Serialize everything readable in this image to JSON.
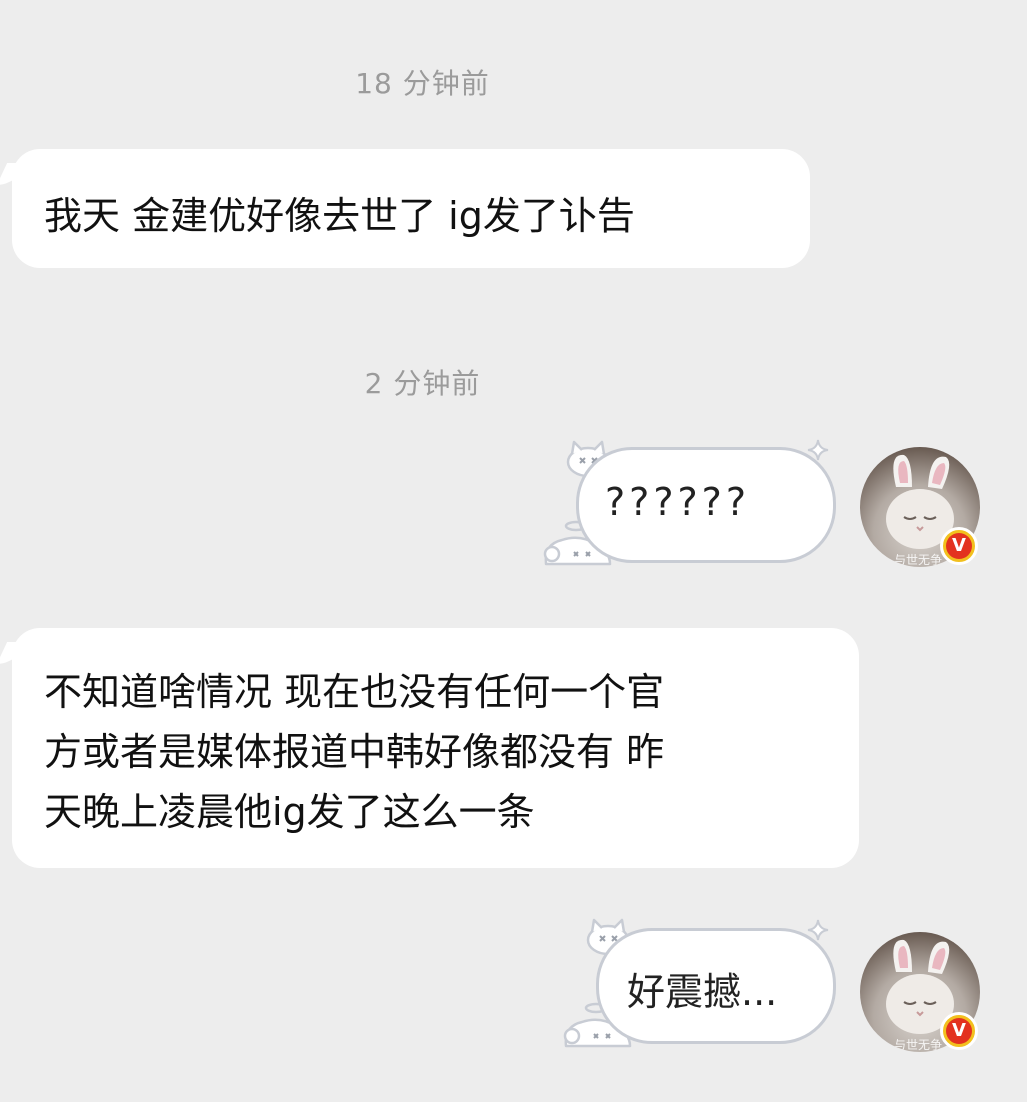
{
  "chat": {
    "messages": [
      {
        "time": "18 分钟前",
        "sender": "other",
        "text": "我天 金建优好像去世了 ig发了讣告"
      },
      {
        "time": "2 分钟前",
        "sender": "me",
        "text": "??????"
      },
      {
        "sender": "other",
        "lines": [
          "不知道啥情况 现在也没有任何一个官",
          "方或者是媒体报道中韩好像都没有 昨",
          "天晚上凌晨他ig发了这么一条"
        ]
      },
      {
        "sender": "me",
        "text": "好震撼..."
      }
    ],
    "avatar": {
      "watermark": "与世无争",
      "badge": "V",
      "icon": "rabbit-ear-cat-avatar"
    },
    "colors": {
      "background": "#ededed",
      "bubble": "#ffffff",
      "bubble_border": "#c8ccd4",
      "timestamp": "#9b9b9b",
      "badge_outer": "#f2c01e",
      "badge_inner": "#e3321f"
    }
  }
}
